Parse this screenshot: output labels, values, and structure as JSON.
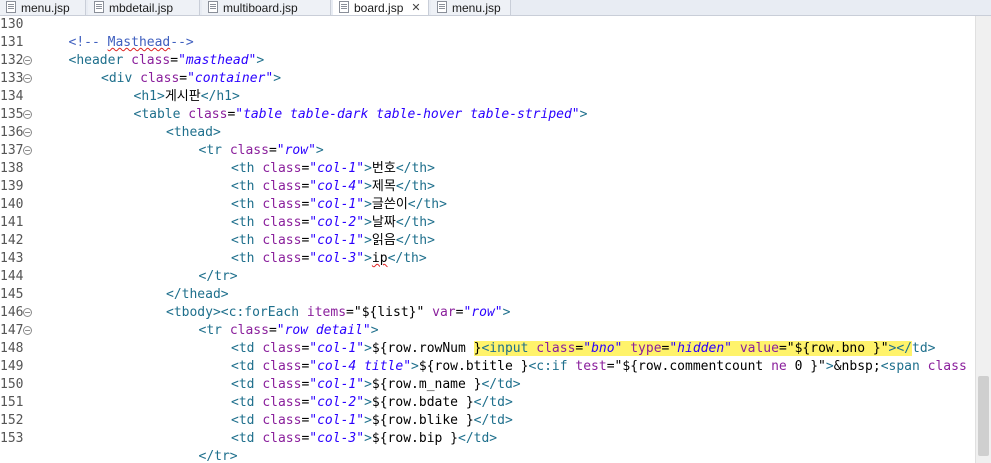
{
  "tabs": [
    {
      "label": "menu.jsp",
      "active": false,
      "closable": false
    },
    {
      "label": "mbdetail.jsp",
      "active": false,
      "closable": false
    },
    {
      "label": "multiboard.jsp",
      "active": false,
      "closable": false
    },
    {
      "label": "board.jsp",
      "active": true,
      "closable": true
    },
    {
      "label": "menu.jsp",
      "active": false,
      "closable": false
    }
  ],
  "close_glyph": "✕",
  "editor": {
    "lines": [
      {
        "n": "130",
        "fold": false,
        "indent": 0,
        "tokens": []
      },
      {
        "n": "131",
        "fold": false,
        "indent": 1,
        "tokens": [
          [
            "comment",
            "<!-- "
          ],
          [
            "comment wavy",
            "Masthead"
          ],
          [
            "comment",
            "-->"
          ]
        ]
      },
      {
        "n": "132",
        "fold": true,
        "indent": 1,
        "tokens": [
          [
            "tag",
            "<header"
          ],
          [
            "el",
            " "
          ],
          [
            "attr",
            "class"
          ],
          [
            "punc",
            "="
          ],
          [
            "val",
            "\"masthead\""
          ],
          [
            "tag",
            ">"
          ]
        ]
      },
      {
        "n": "133",
        "fold": true,
        "indent": 2,
        "tokens": [
          [
            "tag",
            "<div"
          ],
          [
            "el",
            " "
          ],
          [
            "attr",
            "class"
          ],
          [
            "punc",
            "="
          ],
          [
            "val",
            "\"container\""
          ],
          [
            "tag",
            ">"
          ]
        ]
      },
      {
        "n": "134",
        "fold": false,
        "indent": 3,
        "tokens": [
          [
            "tag",
            "<h1>"
          ],
          [
            "txt",
            "게시판"
          ],
          [
            "tag",
            "</h1>"
          ]
        ]
      },
      {
        "n": "135",
        "fold": true,
        "indent": 3,
        "tokens": [
          [
            "tag",
            "<table"
          ],
          [
            "el",
            " "
          ],
          [
            "attr",
            "class"
          ],
          [
            "punc",
            "="
          ],
          [
            "val",
            "\"table table-dark table-hover table-striped\""
          ],
          [
            "tag",
            ">"
          ]
        ]
      },
      {
        "n": "136",
        "fold": true,
        "indent": 4,
        "tokens": [
          [
            "tag",
            "<thead>"
          ]
        ]
      },
      {
        "n": "137",
        "fold": true,
        "indent": 5,
        "tokens": [
          [
            "tag",
            "<tr"
          ],
          [
            "el",
            " "
          ],
          [
            "attr",
            "class"
          ],
          [
            "punc",
            "="
          ],
          [
            "val",
            "\"row\""
          ],
          [
            "tag",
            ">"
          ]
        ]
      },
      {
        "n": "138",
        "fold": false,
        "indent": 6,
        "tokens": [
          [
            "tag",
            "<th"
          ],
          [
            "el",
            " "
          ],
          [
            "attr",
            "class"
          ],
          [
            "punc",
            "="
          ],
          [
            "val",
            "\"col-1\""
          ],
          [
            "tag",
            ">"
          ],
          [
            "txt",
            "번호"
          ],
          [
            "tag",
            "</th>"
          ]
        ]
      },
      {
        "n": "139",
        "fold": false,
        "indent": 6,
        "tokens": [
          [
            "tag",
            "<th"
          ],
          [
            "el",
            " "
          ],
          [
            "attr",
            "class"
          ],
          [
            "punc",
            "="
          ],
          [
            "val",
            "\"col-4\""
          ],
          [
            "tag",
            ">"
          ],
          [
            "txt",
            "제목"
          ],
          [
            "tag",
            "</th>"
          ]
        ]
      },
      {
        "n": "140",
        "fold": false,
        "indent": 6,
        "tokens": [
          [
            "tag",
            "<th"
          ],
          [
            "el",
            " "
          ],
          [
            "attr",
            "class"
          ],
          [
            "punc",
            "="
          ],
          [
            "val",
            "\"col-1\""
          ],
          [
            "tag",
            ">"
          ],
          [
            "txt",
            "글쓴이"
          ],
          [
            "tag",
            "</th>"
          ]
        ]
      },
      {
        "n": "141",
        "fold": false,
        "indent": 6,
        "tokens": [
          [
            "tag",
            "<th"
          ],
          [
            "el",
            " "
          ],
          [
            "attr",
            "class"
          ],
          [
            "punc",
            "="
          ],
          [
            "val",
            "\"col-2\""
          ],
          [
            "tag",
            ">"
          ],
          [
            "txt",
            "날짜"
          ],
          [
            "tag",
            "</th>"
          ]
        ]
      },
      {
        "n": "142",
        "fold": false,
        "indent": 6,
        "tokens": [
          [
            "tag",
            "<th"
          ],
          [
            "el",
            " "
          ],
          [
            "attr",
            "class"
          ],
          [
            "punc",
            "="
          ],
          [
            "val",
            "\"col-1\""
          ],
          [
            "tag",
            ">"
          ],
          [
            "txt",
            "읽음"
          ],
          [
            "tag",
            "</th>"
          ]
        ]
      },
      {
        "n": "143",
        "fold": false,
        "indent": 6,
        "tokens": [
          [
            "tag",
            "<th"
          ],
          [
            "el",
            " "
          ],
          [
            "attr",
            "class"
          ],
          [
            "punc",
            "="
          ],
          [
            "val",
            "\"col-3\""
          ],
          [
            "tag",
            ">"
          ],
          [
            "txt wavy",
            "ip"
          ],
          [
            "tag",
            "</th>"
          ]
        ]
      },
      {
        "n": "144",
        "fold": false,
        "indent": 5,
        "tokens": [
          [
            "tag",
            "</tr>"
          ]
        ]
      },
      {
        "n": "145",
        "fold": false,
        "indent": 4,
        "tokens": [
          [
            "tag",
            "</thead>"
          ]
        ]
      },
      {
        "n": "146",
        "fold": true,
        "indent": 4,
        "tokens": [
          [
            "tag",
            "<tbody>"
          ],
          [
            "tag",
            "<c:forEach"
          ],
          [
            "el",
            " "
          ],
          [
            "attr",
            "items"
          ],
          [
            "punc",
            "="
          ],
          [
            "txt",
            "\"${list}\""
          ],
          [
            "el",
            " "
          ],
          [
            "attr",
            "var"
          ],
          [
            "punc",
            "="
          ],
          [
            "val",
            "\"row\""
          ],
          [
            "tag",
            ">"
          ]
        ]
      },
      {
        "n": "147",
        "fold": true,
        "indent": 5,
        "tokens": [
          [
            "tag",
            "<tr"
          ],
          [
            "el",
            " "
          ],
          [
            "attr",
            "class"
          ],
          [
            "punc",
            "="
          ],
          [
            "val",
            "\"row detail\""
          ],
          [
            "tag",
            ">"
          ]
        ]
      },
      {
        "n": "148",
        "fold": false,
        "indent": 6,
        "tokens": [
          [
            "tag",
            "<td"
          ],
          [
            "el",
            " "
          ],
          [
            "attr",
            "class"
          ],
          [
            "punc",
            "="
          ],
          [
            "val",
            "\"col-1\""
          ],
          [
            "tag",
            ">"
          ],
          [
            "txt",
            "${row.rowNum "
          ],
          [
            "txt hl",
            "}"
          ],
          [
            "tag hl",
            "<input"
          ],
          [
            "el hl",
            " "
          ],
          [
            "attr hl",
            "class"
          ],
          [
            "punc hl",
            "="
          ],
          [
            "val hl",
            "\"bno\""
          ],
          [
            "el hl",
            " "
          ],
          [
            "attr hl",
            "type"
          ],
          [
            "punc hl",
            "="
          ],
          [
            "val hl",
            "\"hidden\""
          ],
          [
            "el hl",
            " "
          ],
          [
            "attr hl",
            "value"
          ],
          [
            "punc hl",
            "="
          ],
          [
            "txt hl",
            "\"${row.bno }\""
          ],
          [
            "tag hl",
            "></"
          ],
          [
            "tag",
            "td>"
          ]
        ]
      },
      {
        "n": "149",
        "fold": false,
        "indent": 6,
        "tokens": [
          [
            "tag",
            "<td"
          ],
          [
            "el",
            " "
          ],
          [
            "attr",
            "class"
          ],
          [
            "punc",
            "="
          ],
          [
            "val",
            "\"col-4 title\""
          ],
          [
            "tag",
            ">"
          ],
          [
            "txt",
            "${row.btitle }"
          ],
          [
            "tag",
            "<c:if"
          ],
          [
            "el",
            " "
          ],
          [
            "attr",
            "test"
          ],
          [
            "punc",
            "="
          ],
          [
            "txt",
            "\"${row.commentcount "
          ],
          [
            "attr",
            "ne"
          ],
          [
            "txt",
            " 0 }\""
          ],
          [
            "tag",
            ">"
          ],
          [
            "txt",
            "&nbsp;"
          ],
          [
            "tag",
            "<span"
          ],
          [
            "el",
            " "
          ],
          [
            "attr",
            "class"
          ]
        ]
      },
      {
        "n": "150",
        "fold": false,
        "indent": 6,
        "tokens": [
          [
            "tag",
            "<td"
          ],
          [
            "el",
            " "
          ],
          [
            "attr",
            "class"
          ],
          [
            "punc",
            "="
          ],
          [
            "val",
            "\"col-1\""
          ],
          [
            "tag",
            ">"
          ],
          [
            "txt",
            "${row.m_name }"
          ],
          [
            "tag",
            "</td>"
          ]
        ]
      },
      {
        "n": "151",
        "fold": false,
        "indent": 6,
        "tokens": [
          [
            "tag",
            "<td"
          ],
          [
            "el",
            " "
          ],
          [
            "attr",
            "class"
          ],
          [
            "punc",
            "="
          ],
          [
            "val",
            "\"col-2\""
          ],
          [
            "tag",
            ">"
          ],
          [
            "txt",
            "${row.bdate }"
          ],
          [
            "tag",
            "</td>"
          ]
        ]
      },
      {
        "n": "152",
        "fold": false,
        "indent": 6,
        "tokens": [
          [
            "tag",
            "<td"
          ],
          [
            "el",
            " "
          ],
          [
            "attr",
            "class"
          ],
          [
            "punc",
            "="
          ],
          [
            "val",
            "\"col-1\""
          ],
          [
            "tag",
            ">"
          ],
          [
            "txt",
            "${row.blike }"
          ],
          [
            "tag",
            "</td>"
          ]
        ]
      },
      {
        "n": "153",
        "fold": false,
        "indent": 6,
        "tokens": [
          [
            "tag",
            "<td"
          ],
          [
            "el",
            " "
          ],
          [
            "attr",
            "class"
          ],
          [
            "punc",
            "="
          ],
          [
            "val",
            "\"col-3\""
          ],
          [
            "tag",
            ">"
          ],
          [
            "txt",
            "${row.bip }"
          ],
          [
            "tag",
            "</td>"
          ]
        ]
      },
      {
        "n": "",
        "fold": false,
        "indent": 5,
        "tokens": [
          [
            "tag",
            "</tr>"
          ]
        ]
      }
    ]
  }
}
